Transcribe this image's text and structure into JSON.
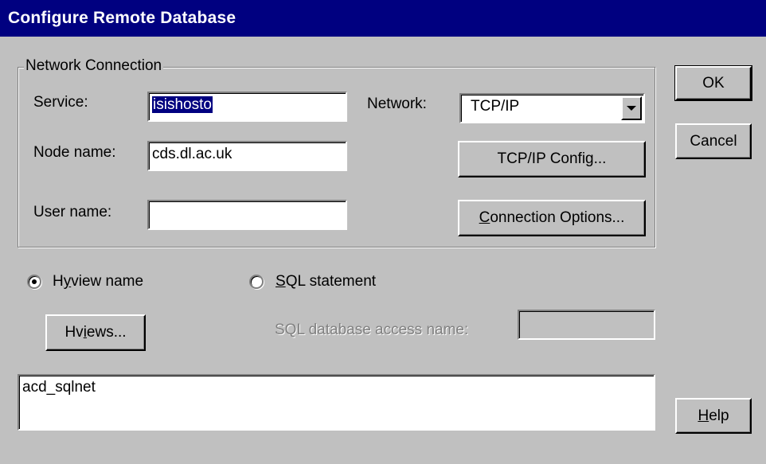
{
  "window": {
    "title": "Configure Remote Database"
  },
  "network_connection": {
    "legend": "Network Connection",
    "service": {
      "label": "Service:",
      "value": "isishosto"
    },
    "node_name": {
      "label": "Node name:",
      "value": "cds.dl.ac.uk"
    },
    "user_name": {
      "label": "User name:",
      "value": ""
    },
    "network": {
      "label": "Network:",
      "selected": "TCP/IP"
    },
    "tcpip_config_button": "TCP/IP Config...",
    "connection_options_button": {
      "mnemonic": "C",
      "rest": "onnection Options..."
    }
  },
  "source": {
    "hview_radio": {
      "pre": "H",
      "mnemonic": "y",
      "rest": "view name",
      "checked": true
    },
    "sql_radio": {
      "pre": "",
      "mnemonic": "S",
      "rest": "QL statement",
      "checked": false
    },
    "hviews_button": {
      "pre": "Hv",
      "mnemonic": "i",
      "rest": "ews..."
    },
    "sql_access_label": "SQL database access name:",
    "sql_access_value": "",
    "text_value": "acd_sqlnet"
  },
  "buttons": {
    "ok": "OK",
    "cancel": "Cancel",
    "help": {
      "mnemonic": "H",
      "rest": "elp"
    }
  },
  "colors": {
    "face": "#c0c0c0",
    "titlebar": "#000080",
    "selection": "#000080",
    "disabled_text": "#808080"
  }
}
